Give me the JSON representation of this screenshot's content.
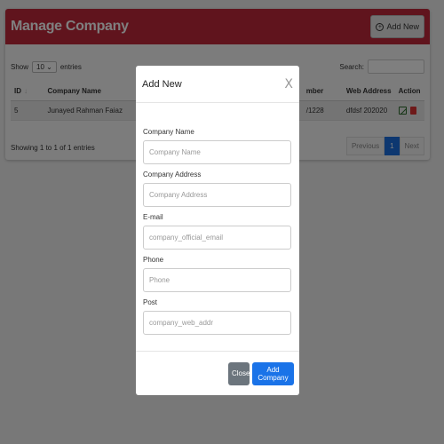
{
  "page": {
    "title": "Manage Company",
    "add_new_label": "Add New",
    "show_label": "Show",
    "entries_label": "entries",
    "page_size": "10",
    "search_label": "Search:",
    "table": {
      "headers": [
        "ID",
        "Company Name",
        "mber",
        "Web Address",
        "Action"
      ],
      "rows": [
        {
          "id": "5",
          "name": "Junayed Rahman Faiaz",
          "number": "/1228",
          "web": "dfdsf 202020"
        }
      ]
    },
    "info": "Showing 1 to 1 of 1 entries",
    "pager": {
      "previous": "Previous",
      "current": "1",
      "next": "Next"
    }
  },
  "modal": {
    "title": "Add New",
    "close_x": "X",
    "fields": [
      {
        "label": "Company Name",
        "placeholder": "Company Name"
      },
      {
        "label": "Company Address",
        "placeholder": "Company Address"
      },
      {
        "label": "E-mail",
        "placeholder": "company_official_email"
      },
      {
        "label": "Phone",
        "placeholder": "Phone"
      },
      {
        "label": "Post",
        "placeholder": "company_web_addr"
      }
    ],
    "close_label": "Close",
    "submit_label": "Add Company"
  },
  "colors": {
    "header": "#c0283a",
    "primary": "#1a73e8",
    "secondary": "#6c757d"
  }
}
